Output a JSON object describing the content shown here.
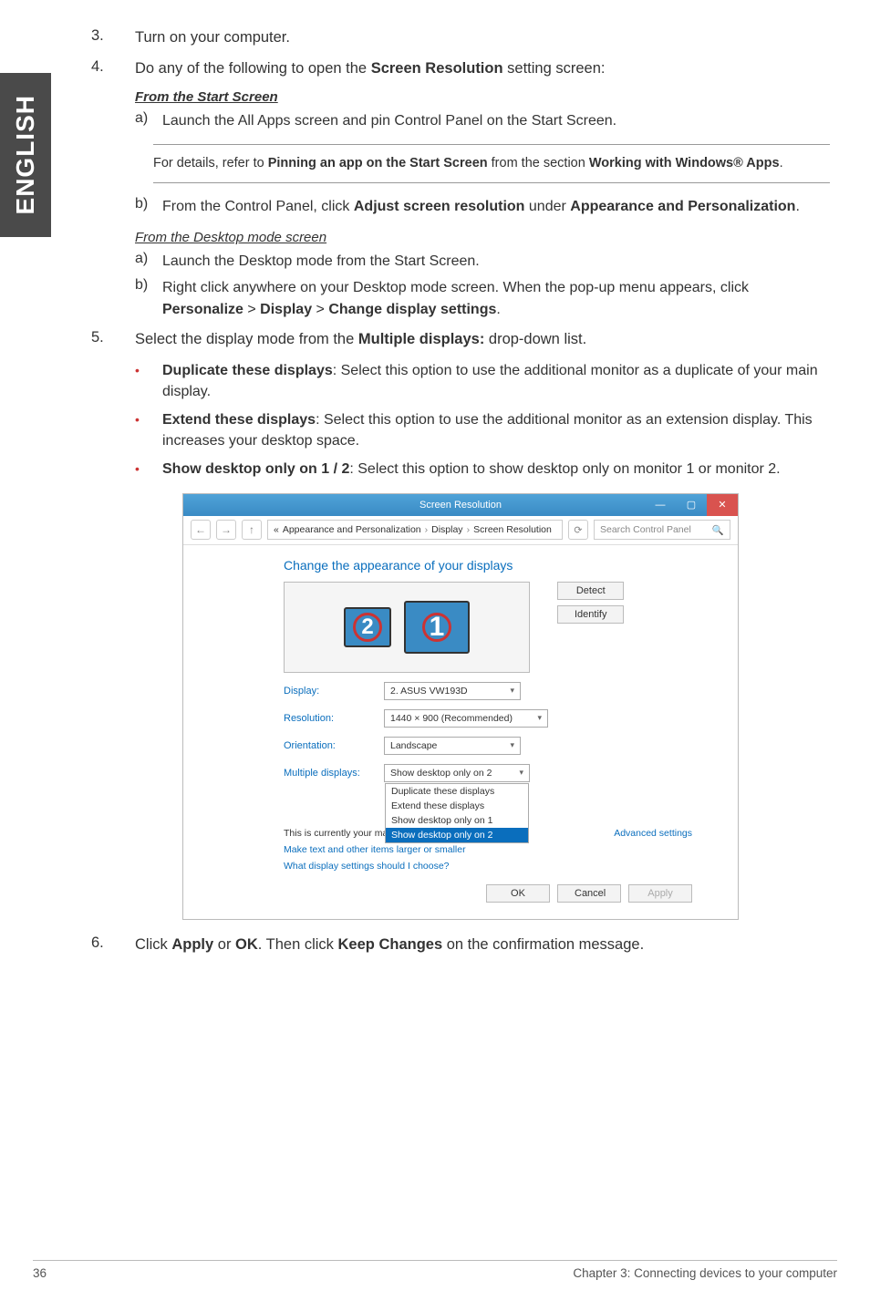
{
  "side_tab": "ENGLISH",
  "steps": {
    "s3": {
      "num": "3.",
      "text": "Turn on your computer."
    },
    "s4": {
      "num": "4.",
      "intro_a": "Do any of the following to open the ",
      "intro_b": "Screen Resolution",
      "intro_c": " setting screen:",
      "from_start": "From the Start Screen",
      "a4a": {
        "mark": "a)",
        "text": "Launch the All Apps screen and pin Control Panel on the Start Screen."
      },
      "note": {
        "a": "For details, refer to ",
        "b": "Pinning an app on the Start Screen",
        "c": " from the section ",
        "d": "Working with Windows® Apps",
        "e": "."
      },
      "a4b": {
        "mark": "b)",
        "a": "From the Control Panel, click ",
        "b": "Adjust screen resolution",
        "c": " under ",
        "d": "Appearance and Personalization",
        "e": "."
      },
      "from_desktop": "From the Desktop mode screen",
      "d4a": {
        "mark": "a)",
        "text": "Launch the Desktop mode from the Start Screen."
      },
      "d4b": {
        "mark": "b)",
        "a": "Right click anywhere on your Desktop mode screen. When the pop-up menu appears, click ",
        "b": "Personalize",
        "c": " > ",
        "d": "Display",
        "e": " > ",
        "f": "Change display settings",
        "g": "."
      }
    },
    "s5": {
      "num": "5.",
      "a": "Select the display mode from the ",
      "b": "Multiple displays:",
      "c": " drop-down list.",
      "bul1": {
        "a": "Duplicate these displays",
        "b": ": Select this option to use the additional monitor as a duplicate of your main display."
      },
      "bul2": {
        "a": "Extend these displays",
        "b": ": Select this option to use the additional monitor as an extension display. This increases your desktop space."
      },
      "bul3": {
        "a": "Show desktop only on 1 / 2",
        "b": ": Select this option to show desktop only on monitor 1 or monitor 2."
      }
    },
    "s6": {
      "num": "6.",
      "a": "Click ",
      "b": "Apply",
      "c": " or ",
      "d": "OK",
      "e": ". Then click ",
      "f": "Keep Changes",
      "g": " on the confirmation message."
    }
  },
  "shot": {
    "title": "Screen Resolution",
    "bc1": "Appearance and Personalization",
    "bc2": "Display",
    "bc3": "Screen Resolution",
    "search_ph": "Search Control Panel",
    "heading": "Change the appearance of your displays",
    "detect": "Detect",
    "identify": "Identify",
    "mon1": "1",
    "mon2": "2",
    "lbl_display": "Display:",
    "val_display": "2. ASUS VW193D",
    "lbl_res": "Resolution:",
    "val_res": "1440 × 900 (Recommended)",
    "lbl_orient": "Orientation:",
    "val_orient": "Landscape",
    "lbl_multi": "Multiple displays:",
    "val_multi": "Show desktop only on 2",
    "dd": {
      "o1": "Duplicate these displays",
      "o2": "Extend these displays",
      "o3": "Show desktop only on 1",
      "o4": "Show desktop only on 2"
    },
    "note_line": "This is currently your main display.",
    "adv": "Advanced settings",
    "link1": "Make text and other items larger or smaller",
    "link2": "What display settings should I choose?",
    "ok": "OK",
    "cancel": "Cancel",
    "apply": "Apply"
  },
  "footer": {
    "page": "36",
    "chapter": "Chapter 3: Connecting devices to your computer"
  }
}
